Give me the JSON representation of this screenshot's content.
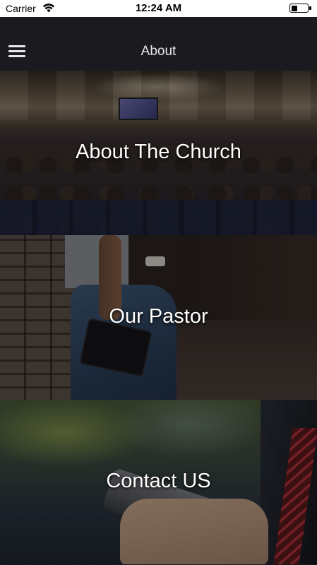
{
  "status_bar": {
    "carrier": "Carrier",
    "time": "12:24 AM",
    "battery_level": 0.45
  },
  "navbar": {
    "title": "About",
    "menu_icon": "hamburger-menu-icon"
  },
  "cards": [
    {
      "label": "About The Church"
    },
    {
      "label": "Our Pastor"
    },
    {
      "label": "Contact US"
    }
  ]
}
